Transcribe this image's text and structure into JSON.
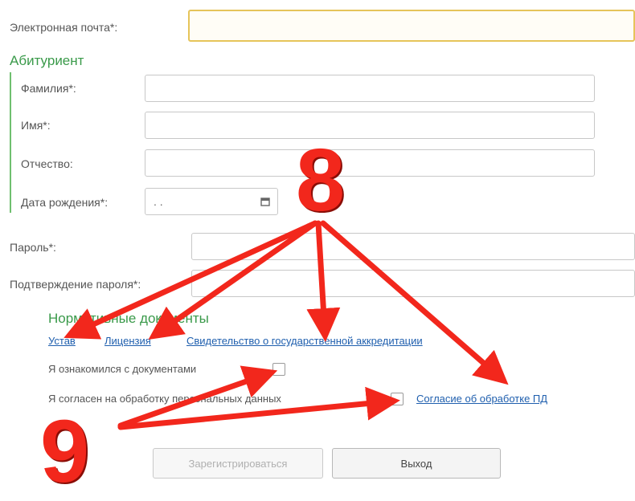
{
  "email": {
    "label": "Электронная почта*:",
    "value": ""
  },
  "applicant": {
    "title": "Абитуриент",
    "surname_label": "Фамилия*:",
    "name_label": "Имя*:",
    "patronymic_label": "Отчество:",
    "birthdate_label": "Дата рождения*:",
    "birthdate_value": " .  .  "
  },
  "password": {
    "label": "Пароль*:",
    "confirm_label": "Подтверждение пароля*:"
  },
  "documents": {
    "title": "Нормативные документы",
    "links": [
      "Устав",
      "Лицензия",
      "Свидетельство о государственной аккредитации"
    ],
    "ack_label": "Я ознакомился с документами",
    "consent_label": "Я согласен на обработку персональных данных",
    "consent_link": "Согласие об обработке ПД"
  },
  "buttons": {
    "register": "Зарегистрироваться",
    "exit": "Выход"
  },
  "annotations": {
    "marker_8": "8",
    "marker_9": "9",
    "color": "#f2271c"
  },
  "icons": {
    "calendar": "calendar-icon"
  }
}
